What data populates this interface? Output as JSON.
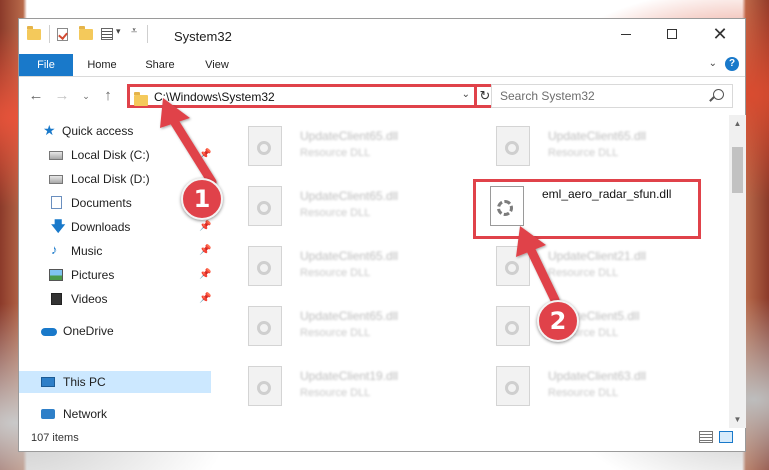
{
  "window": {
    "title": "System32",
    "controls": {
      "minimize": "minimize",
      "maximize": "maximize",
      "close": "✕"
    }
  },
  "ribbon": {
    "tabs": [
      "File",
      "Home",
      "Share",
      "View"
    ],
    "help": "?"
  },
  "navigation": {
    "address": "C:\\Windows\\System32",
    "search_placeholder": "Search System32"
  },
  "sidebar": {
    "items": [
      {
        "label": "Quick access",
        "icon": "star-icon"
      },
      {
        "label": "Local Disk (C:)",
        "icon": "drive-icon",
        "pinned": true
      },
      {
        "label": "Local Disk (D:)",
        "icon": "drive-icon"
      },
      {
        "label": "Documents",
        "icon": "document-icon",
        "pinned": true
      },
      {
        "label": "Downloads",
        "icon": "download-icon",
        "pinned": true
      },
      {
        "label": "Music",
        "icon": "music-icon",
        "pinned": true
      },
      {
        "label": "Pictures",
        "icon": "pictures-icon",
        "pinned": true
      },
      {
        "label": "Videos",
        "icon": "videos-icon",
        "pinned": true
      },
      {
        "label": "OneDrive",
        "icon": "cloud-icon"
      },
      {
        "label": "This PC",
        "icon": "computer-icon",
        "selected": true
      },
      {
        "label": "Network",
        "icon": "network-icon"
      }
    ]
  },
  "files": [
    {
      "name": "UpdateClient65.dll",
      "type": "Resource DLL"
    },
    {
      "name": "UpdateClient65.dll",
      "type": "Resource DLL"
    },
    {
      "name": "UpdateClient65.dll",
      "type": "Resource DLL"
    },
    {
      "name": "eml_aero_radar_sfun.dll",
      "type": ""
    },
    {
      "name": "UpdateClient65.dll",
      "type": "Resource DLL"
    },
    {
      "name": "UpdateClient21.dll",
      "type": "Resource DLL"
    },
    {
      "name": "UpdateClient65.dll",
      "type": "Resource DLL"
    },
    {
      "name": "UpdateClient5.dll",
      "type": "Resource DLL"
    },
    {
      "name": "UpdateClient19.dll",
      "type": "Resource DLL"
    },
    {
      "name": "UpdateClient63.dll",
      "type": "Resource DLL"
    }
  ],
  "status": {
    "item_count": "107 items"
  },
  "annotations": {
    "step1": "1",
    "step2": "2"
  },
  "colors": {
    "accent": "#1979ca",
    "annotation_red": "#e0424a",
    "selected_bg": "#cce8ff"
  }
}
